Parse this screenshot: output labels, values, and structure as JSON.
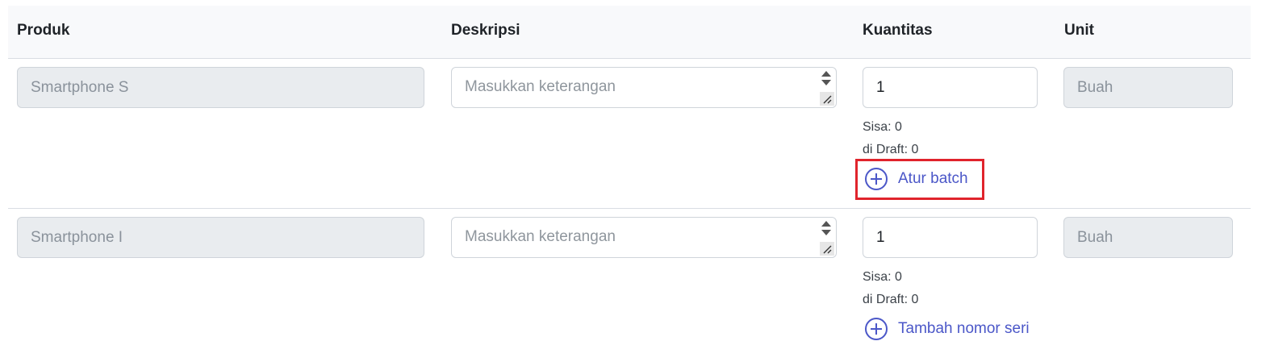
{
  "headers": {
    "product": "Produk",
    "description": "Deskripsi",
    "quantity": "Kuantitas",
    "unit": "Unit"
  },
  "rows": [
    {
      "product": "Smartphone S",
      "description_placeholder": "Masukkan keterangan",
      "quantity": "1",
      "unit": "Buah",
      "remaining": "Sisa: 0",
      "in_draft": "di Draft: 0",
      "action_label": "Atur batch",
      "action_icon": "plus-circle-icon"
    },
    {
      "product": "Smartphone I",
      "description_placeholder": "Masukkan keterangan",
      "quantity": "1",
      "unit": "Buah",
      "remaining": "Sisa: 0",
      "in_draft": "di Draft: 0",
      "action_label": "Tambah nomor seri",
      "action_icon": "plus-circle-icon"
    }
  ],
  "colors": {
    "accent": "#4b57c8",
    "highlight": "#e0242c",
    "header_bg": "#f8f9fb",
    "readonly_bg": "#e9ecef"
  }
}
